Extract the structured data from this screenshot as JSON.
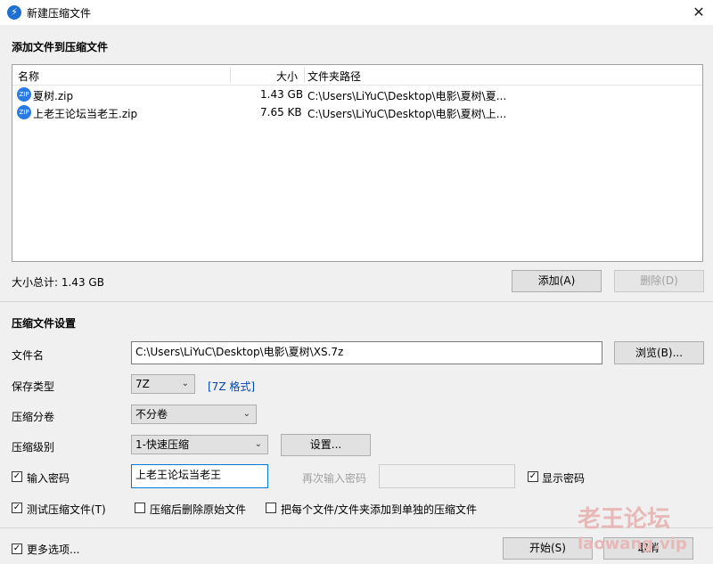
{
  "window": {
    "title": "新建压缩文件",
    "close_symbol": "✕"
  },
  "add_section": {
    "title": "添加文件到压缩文件"
  },
  "file_list": {
    "columns": [
      "名称",
      "大小",
      "文件夹路径"
    ],
    "rows": [
      {
        "name": "夏树.zip",
        "size": "1.43 GB",
        "path": "C:\\Users\\LiYuC\\Desktop\\电影\\夏树\\夏..."
      },
      {
        "name": "上老王论坛当老王.zip",
        "size": "7.65 KB",
        "path": "C:\\Users\\LiYuC\\Desktop\\电影\\夏树\\上..."
      }
    ],
    "file_icon_text": "ZIP"
  },
  "total_size": "大小总计: 1.43 GB",
  "buttons": {
    "add": "添加(A)",
    "delete": "删除(D)",
    "browse": "浏览(B)...",
    "settings": "设置...",
    "start": "开始(S)",
    "cancel": "取消"
  },
  "settings_section": {
    "title": "压缩文件设置"
  },
  "filename": {
    "label": "文件名",
    "value": "C:\\Users\\LiYuC\\Desktop\\电影\\夏树\\XS.7z"
  },
  "save_type": {
    "label": "保存类型",
    "value": "7Z",
    "link": "[7Z 格式]"
  },
  "split": {
    "label": "压缩分卷",
    "value": "不分卷"
  },
  "level": {
    "label": "压缩级别",
    "value": "1-快速压缩"
  },
  "password": {
    "label": "输入密码",
    "value": "上老王论坛当老王",
    "reenter_label": "再次输入密码",
    "show_label": "显示密码"
  },
  "options": {
    "test_archive": "测试压缩文件(T)",
    "delete_after": "压缩后删除原始文件",
    "separate": "把每个文件/文件夹添加到单独的压缩文件"
  },
  "more_options": "更多选项...",
  "checkmark": "✓",
  "watermark": {
    "line1": "老王论坛",
    "line2": "laowang.vip"
  },
  "colors": {
    "accent": "#0078d7",
    "link": "#0645ad",
    "icon": "#2a7ae2"
  }
}
